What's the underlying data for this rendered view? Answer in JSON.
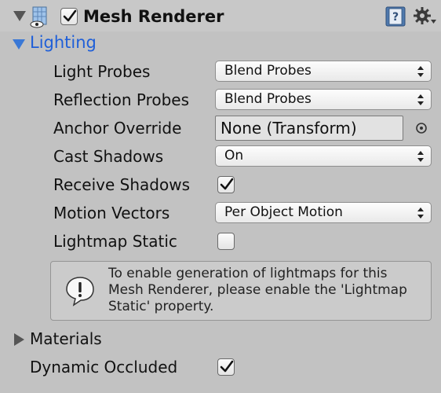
{
  "component": {
    "title": "Mesh Renderer",
    "enabled": true,
    "icon": "mesh-renderer-icon",
    "header_icons": [
      "help-book-icon",
      "gear-icon"
    ]
  },
  "lighting": {
    "label": "Lighting",
    "expanded": true,
    "light_probes": {
      "label": "Light Probes",
      "value": "Blend Probes"
    },
    "reflection_probes": {
      "label": "Reflection Probes",
      "value": "Blend Probes"
    },
    "anchor_override": {
      "label": "Anchor Override",
      "value": "None (Transform)"
    },
    "cast_shadows": {
      "label": "Cast Shadows",
      "value": "On"
    },
    "receive_shadows": {
      "label": "Receive Shadows",
      "checked": true
    },
    "motion_vectors": {
      "label": "Motion Vectors",
      "value": "Per Object Motion"
    },
    "lightmap_static": {
      "label": "Lightmap Static",
      "checked": false
    },
    "help": {
      "line1": "To enable generation of lightmaps for this",
      "line2": "Mesh Renderer, please enable the 'Lightmap",
      "line3": "Static' property."
    }
  },
  "materials": {
    "label": "Materials",
    "expanded": false
  },
  "dynamic_occluded": {
    "label": "Dynamic Occluded",
    "checked": true
  },
  "colors": {
    "panel_bg": "#c2c2c2",
    "foldout_accent": "#1f5fd8"
  }
}
